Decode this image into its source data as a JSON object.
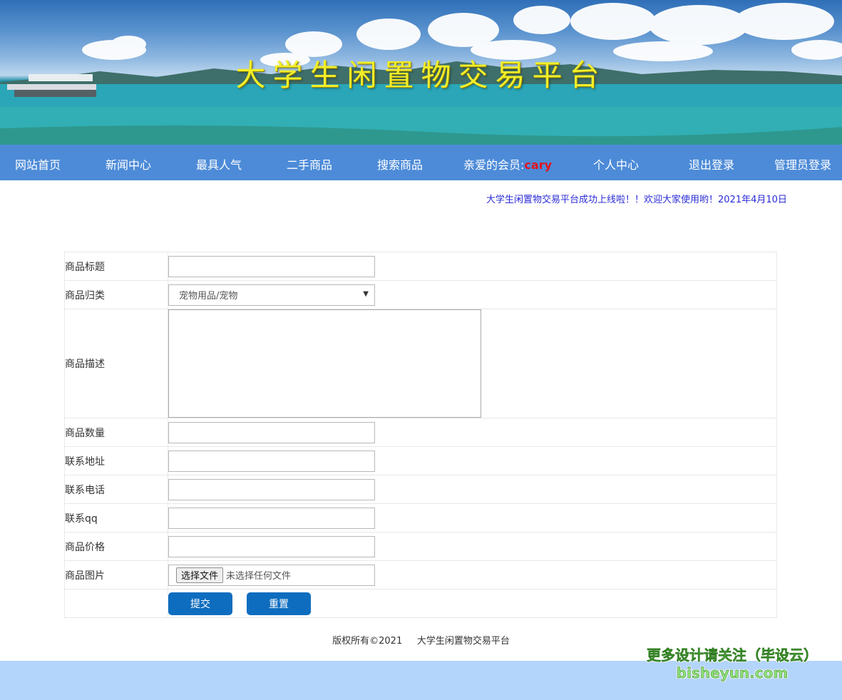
{
  "banner": {
    "title": "大学生闲置物交易平台"
  },
  "nav": {
    "items": [
      {
        "label": "网站首页"
      },
      {
        "label": "新闻中心"
      },
      {
        "label": "最具人气"
      },
      {
        "label": "二手商品"
      },
      {
        "label": "搜索商品"
      },
      {
        "label": "亲爱的会员:",
        "member": "cary"
      },
      {
        "label": "个人中心"
      },
      {
        "label": "退出登录"
      },
      {
        "label": "管理员登录"
      }
    ]
  },
  "marquee": {
    "text": "大学生闲置物交易平台成功上线啦！！欢迎大家使用哟！2021年4月10日"
  },
  "form": {
    "title_label": "商品标题",
    "title_value": "",
    "category_label": "商品归类",
    "category_selected": "宠物用品/宠物",
    "description_label": "商品描述",
    "description_value": "",
    "quantity_label": "商品数量",
    "quantity_value": "",
    "address_label": "联系地址",
    "address_value": "",
    "phone_label": "联系电话",
    "phone_value": "",
    "qq_label": "联系qq",
    "qq_value": "",
    "price_label": "商品价格",
    "price_value": "",
    "image_label": "商品图片",
    "file_button": "选择文件",
    "file_status": "未选择任何文件",
    "submit_label": "提交",
    "reset_label": "重置"
  },
  "footer": {
    "copyright": "版权所有©2021     大学生闲置物交易平台",
    "band_color": "#b3d4fb"
  },
  "watermark": {
    "line1": "更多设计请关注（毕设云）",
    "line2": "bisheyun.com"
  },
  "colors": {
    "nav_bg": "#4d8bd8",
    "member_name": "#e3141c",
    "marquee_text": "#2b2bd6",
    "button_bg": "#0f6dbf",
    "title_yellow": "#f1ee2a"
  }
}
